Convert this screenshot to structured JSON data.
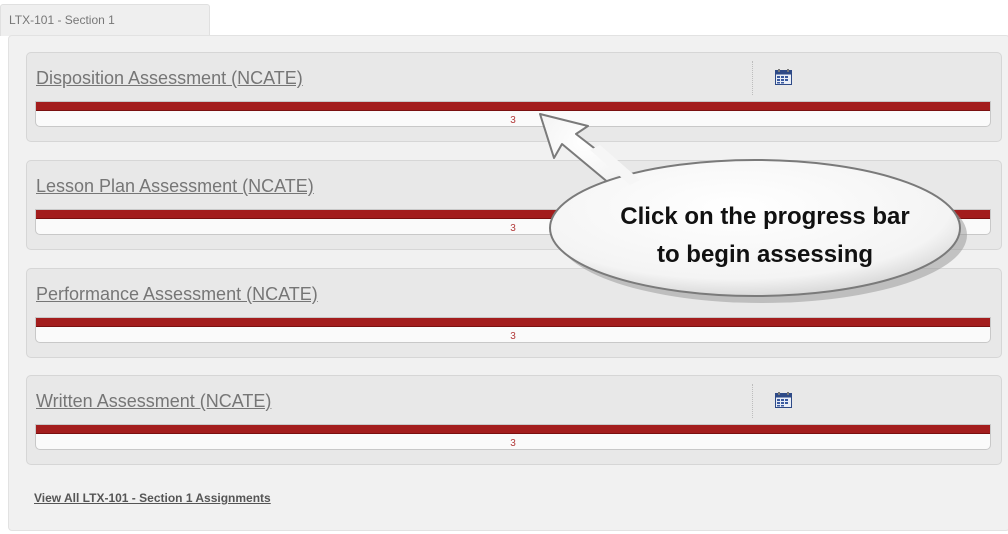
{
  "tab": {
    "label": "LTX-101 - Section 1"
  },
  "cards": [
    {
      "title": "Disposition Assessment (NCATE)",
      "has_calendar": true,
      "progress_count": "3",
      "progress_fraction": 1.0
    },
    {
      "title": "Lesson Plan Assessment (NCATE)",
      "has_calendar": false,
      "progress_count": "3",
      "progress_fraction": 1.0
    },
    {
      "title": "Performance Assessment (NCATE)",
      "has_calendar": false,
      "progress_count": "3",
      "progress_fraction": 1.0
    },
    {
      "title": "Written Assessment (NCATE)",
      "has_calendar": true,
      "progress_count": "3",
      "progress_fraction": 1.0
    }
  ],
  "footer": {
    "view_all_link": "View All LTX-101 - Section 1 Assignments"
  },
  "callout": {
    "line1": "Click on the progress bar",
    "line2": "to begin assessing"
  },
  "icons": {
    "calendar": "calendar-icon"
  },
  "colors": {
    "progress_fill": "#a31d1d",
    "progress_label": "#b33a3a",
    "link": "#767676"
  }
}
